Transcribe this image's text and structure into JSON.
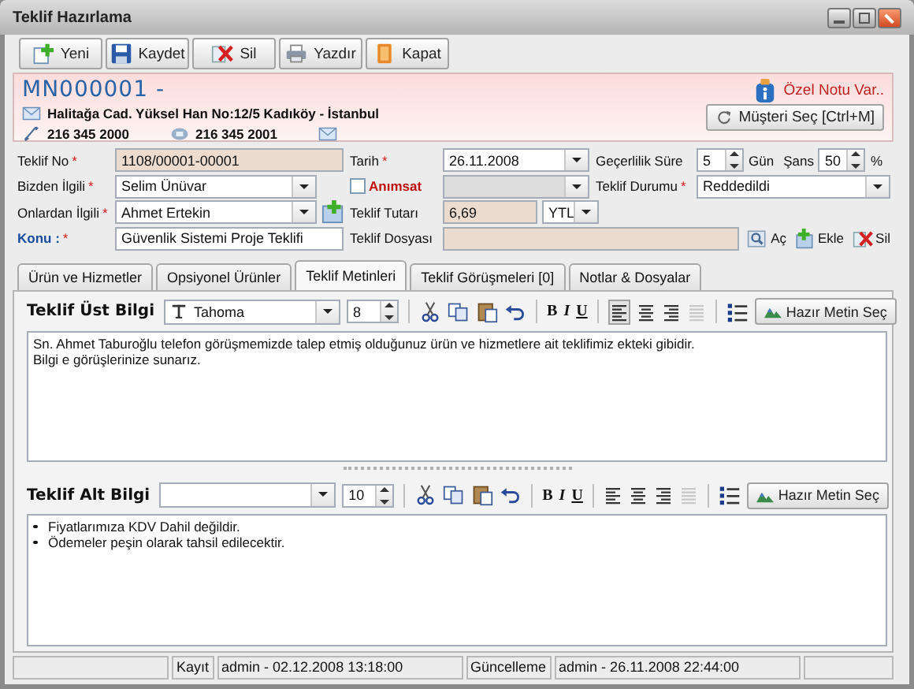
{
  "window": {
    "title": "Teklif Hazırlama"
  },
  "toolbar": [
    {
      "kind": "new",
      "label": "Yeni"
    },
    {
      "kind": "save",
      "label": "Kaydet"
    },
    {
      "kind": "delete",
      "label": "Sil"
    },
    {
      "kind": "print",
      "label": "Yazdır"
    },
    {
      "kind": "close",
      "label": "Kapat"
    }
  ],
  "customer": {
    "code": "MN000001 -",
    "address": "Halitağa Cad. Yüksel Han No:12/5  Kadıköy - İstanbul",
    "phone": "216 345 2000",
    "fax": "216 345 2001",
    "note": "Özel Notu Var..",
    "select_button": "Müşteri Seç [Ctrl+M]"
  },
  "form": {
    "offer_no": {
      "label": "Teklif No",
      "mark": "*",
      "value": "1108/00001-00001"
    },
    "our_contact": {
      "label": "Bizden İlgili",
      "mark": "*",
      "value": "Selim Ünüvar"
    },
    "their_contact": {
      "label": "Onlardan İlgili",
      "mark": "*",
      "value": "Ahmet Ertekin"
    },
    "subject": {
      "label": "Konu :",
      "mark": "*",
      "value": "Güvenlik Sistemi Proje Teklifi"
    },
    "date": {
      "label": "Tarih",
      "mark": "*",
      "value": "26.11.2008"
    },
    "reminder": {
      "label": "Anımsat",
      "checked": false
    },
    "amount": {
      "label": "Teklif Tutarı",
      "value": "6,69",
      "currency": "YTL"
    },
    "file": {
      "label": "Teklif Dosyası",
      "actions": [
        {
          "kind": "open",
          "label": "Aç"
        },
        {
          "kind": "add",
          "label": "Ekle"
        },
        {
          "kind": "delete",
          "label": "Sil"
        }
      ]
    },
    "validity": {
      "label": "Geçerlilik Süre",
      "value": "5",
      "unit": "Gün"
    },
    "chance": {
      "label": "Şans",
      "value": "50",
      "unit": "%"
    },
    "status": {
      "label": "Teklif Durumu",
      "mark": "*",
      "value": "Reddedildi"
    }
  },
  "tabs": [
    {
      "label": "Ürün ve Hizmetler",
      "selected": false
    },
    {
      "label": "Opsiyonel Ürünler",
      "selected": false
    },
    {
      "label": "Teklif Metinleri",
      "selected": true
    },
    {
      "label": "Teklif Görüşmeleri [0]",
      "selected": false
    },
    {
      "label": "Notlar & Dosyalar",
      "selected": false
    }
  ],
  "editors": [
    {
      "title": "Teklif Üst Bilgi",
      "font": "Tahoma",
      "size": "8",
      "format_buttons": [
        "B",
        "I",
        "U"
      ],
      "align_buttons": [
        {
          "kind": "left",
          "selected": true,
          "disabled": false
        },
        {
          "kind": "center",
          "selected": false,
          "disabled": false
        },
        {
          "kind": "right",
          "selected": false,
          "disabled": false
        },
        {
          "kind": "justify",
          "selected": false,
          "disabled": true
        }
      ],
      "preset_button": "Hazır Metin Seç",
      "kind": "paragraphs",
      "lines": [
        "Sn. Ahmet Taburoğlu telefon görüşmemizde talep etmiş olduğunuz ürün ve hizmetlere ait teklifimiz ekteki gibidir.",
        "Bilgi e görüşlerinize sunarız."
      ]
    },
    {
      "title": "Teklif Alt Bilgi",
      "size": "10",
      "format_buttons": [
        "B",
        "I",
        "U"
      ],
      "align_buttons": [
        {
          "kind": "left",
          "selected": false,
          "disabled": false
        },
        {
          "kind": "center",
          "selected": false,
          "disabled": false
        },
        {
          "kind": "right",
          "selected": false,
          "disabled": false
        },
        {
          "kind": "justify",
          "selected": false,
          "disabled": true
        }
      ],
      "preset_button": "Hazır Metin Seç",
      "kind": "bullets",
      "lines": [
        "Fiyatlarımıza KDV Dahil değildir.",
        "Ödemeler peşin olarak tahsil edilecektir."
      ]
    }
  ],
  "status_bar": [
    {
      "label": "Kayıt",
      "value": "admin - 02.12.2008 13:18:00"
    },
    {
      "label": "Güncelleme",
      "value": "admin - 26.11.2008 22:44:00"
    }
  ]
}
